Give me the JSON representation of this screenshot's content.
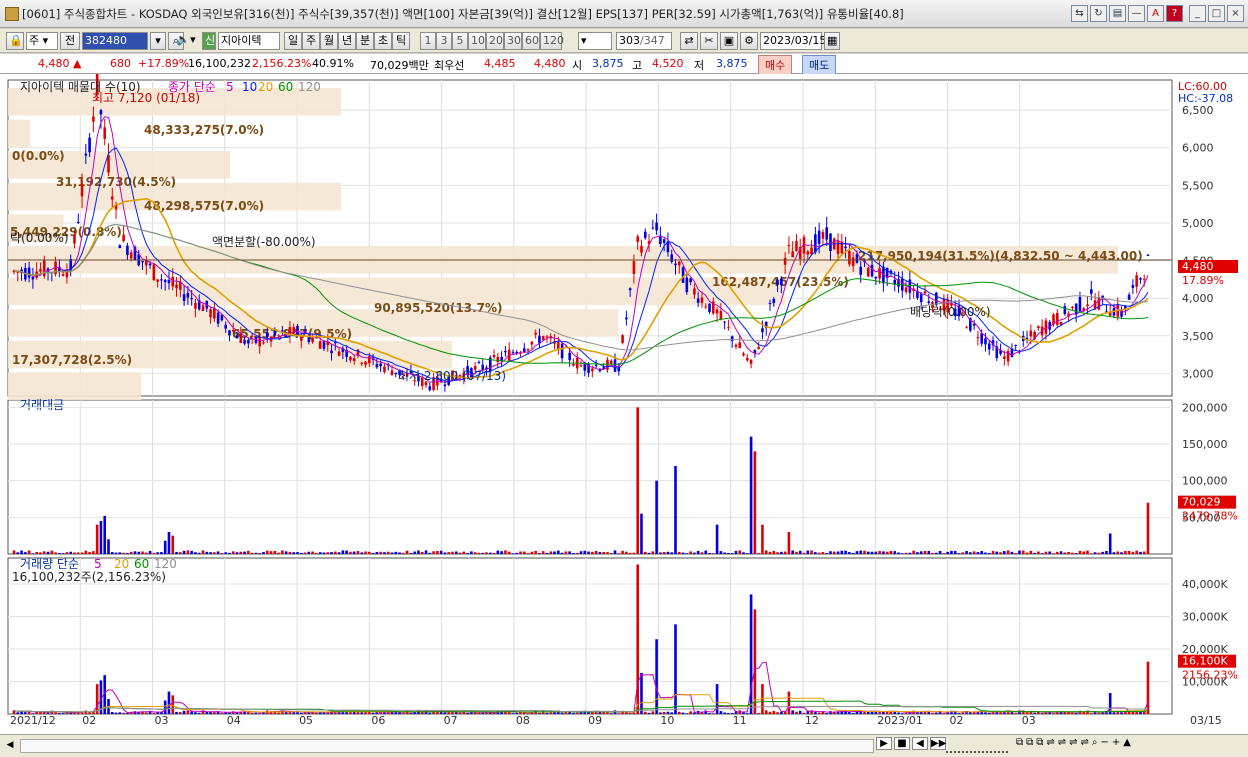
{
  "window": {
    "title": "[0601] 주식종합차트 - KOSDAQ 외국인보유[316(천)] 주식수[39,357(천)] 액면[100] 자본금[39(억)] 결산[12월] EPS[137] PER[32.59] 시가총액[1,763(억)] 유통비율[40.8]"
  },
  "toolbar": {
    "market": "주",
    "side": "전",
    "code": "382480",
    "stock_name": "지아이텍",
    "badge": "신",
    "periods": [
      "일",
      "주",
      "월",
      "년",
      "분",
      "초",
      "틱"
    ],
    "period_selected": "일",
    "intervals": [
      "1",
      "3",
      "5",
      "10",
      "20",
      "30",
      "60",
      "120"
    ],
    "position": "303",
    "total": "/347",
    "date": "2023/03/15"
  },
  "info": {
    "price": "4,480",
    "change": "680",
    "pct": "+17.89%",
    "volume": "16,100,232",
    "turnover": "2,156.23%",
    "rate": "40.91%",
    "amount": "70,029백만",
    "quote_label": "최우선",
    "ask": "4,485",
    "bid": "4,480",
    "open_label": "시",
    "open": "3,875",
    "high_label": "고",
    "high": "4,520",
    "low_label": "저",
    "low": "3,875",
    "buy": "매수",
    "sell": "매도"
  },
  "price_panel": {
    "legend_name": "지아이텍 매물대 수(10)",
    "ma_label": "종가 단순",
    "ma_periods": [
      "5",
      "10",
      "20",
      "60",
      "120"
    ],
    "axis": [
      "6,500",
      "6,000",
      "5,500",
      "5,000",
      "4,500",
      "4,000",
      "3,500",
      "3,000"
    ],
    "lc": "LC:60.00",
    "hc": "HC:-37.08",
    "current_tag": "4,480",
    "current_pct": "17.89%",
    "high_note": "최고 7,120 (01/18)",
    "low_note": "최저 2,800 (07/13)",
    "split_note": "액면분할(-80.00%)",
    "div_note": "배당락(0.00%)",
    "left_note": "락(0.00%)",
    "vp_labels": [
      "48,333,275(7.0%)",
      "0(0.0%)",
      "31,192,730(4.5%)",
      "48,298,575(7.0%)",
      "5,449,229(0.8%)",
      "217,950,194(31.5%)(4,832.50 ~ 4,443.00)",
      "162,487,457(23.5%)",
      "90,895,520(13.7%)",
      "65,557,847(9.5%)",
      "17,307,728(2.5%)"
    ]
  },
  "amount_panel": {
    "title": "거래대금",
    "axis": [
      "200,000",
      "150,000",
      "100,000",
      "50,000"
    ],
    "tag": "70,029",
    "tag_pct": "2479.78%"
  },
  "volume_panel": {
    "title": "거래량 단순",
    "periods": [
      "5",
      "20",
      "60",
      "120"
    ],
    "sub": "16,100,232주(2,156.23%)",
    "axis": [
      "40,000K",
      "30,000K",
      "20,000K",
      "10,000K"
    ],
    "tag": "16,100K",
    "tag_pct": "2156.23%"
  },
  "x_axis": [
    "2021/12",
    "02",
    "03",
    "04",
    "05",
    "06",
    "07",
    "08",
    "09",
    "10",
    "11",
    "12",
    "2023/01",
    "02",
    "03",
    "03/15"
  ],
  "colors": {
    "up": "#e00000",
    "down": "#0000e0",
    "ma5": "#c000c0",
    "ma10": "#0020ff",
    "ma20": "#e0a000",
    "ma60": "#009000",
    "ma120": "#909090",
    "profile": "#f5e6d3"
  }
}
